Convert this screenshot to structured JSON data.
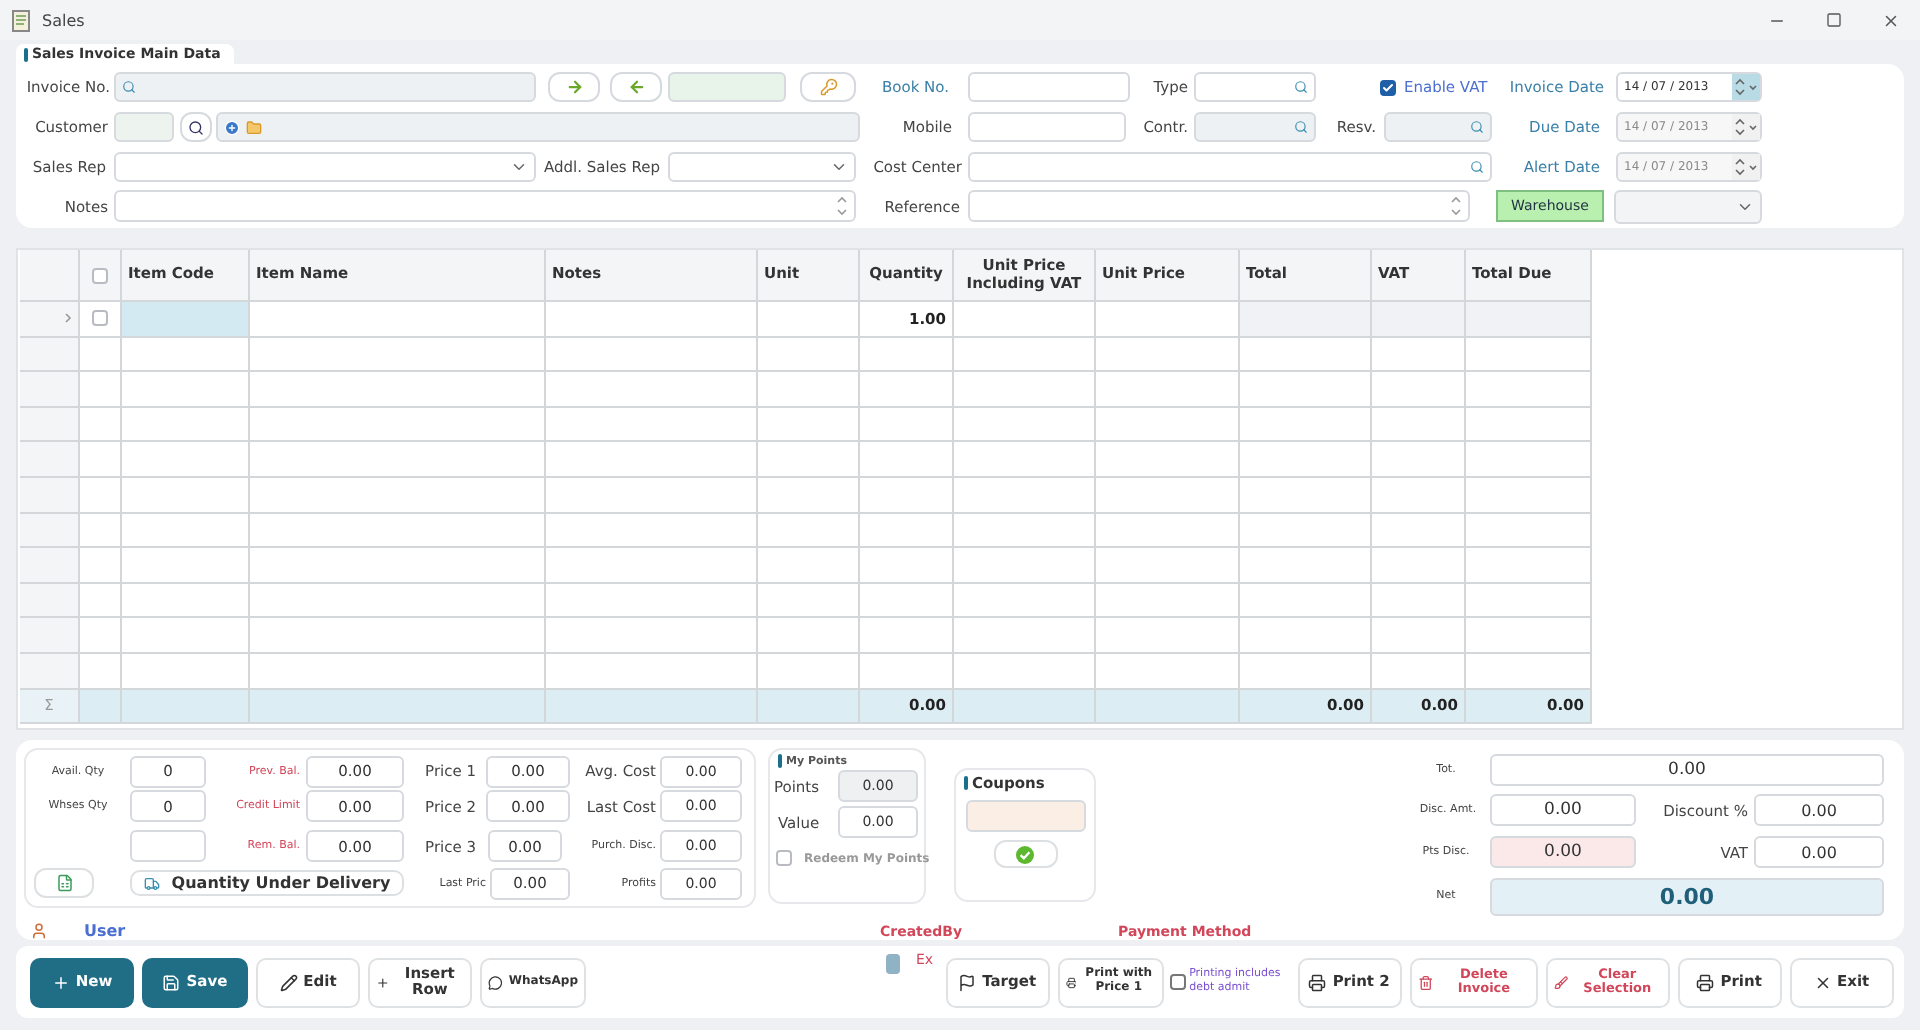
{
  "window": {
    "title": "Sales"
  },
  "main_data": {
    "title": "Sales Invoice Main Data",
    "invoice_no": {
      "label": "Invoice No."
    },
    "book_no": {
      "label": "Book No."
    },
    "type": {
      "label": "Type"
    },
    "enable_vat": {
      "label": "Enable VAT",
      "checked": true
    },
    "invoice_date": {
      "label": "Invoice Date",
      "value": "14 / 07 / 2013",
      "disabled": false
    },
    "customer": {
      "label": "Customer"
    },
    "mobile": {
      "label": "Mobile"
    },
    "contr": {
      "label": "Contr."
    },
    "resv": {
      "label": "Resv."
    },
    "due_date": {
      "label": "Due Date",
      "value": "14 / 07 / 2013",
      "disabled": true
    },
    "sales_rep": {
      "label": "Sales Rep"
    },
    "addl_sales_rep": {
      "label": "Addl. Sales Rep"
    },
    "cost_center": {
      "label": "Cost Center"
    },
    "alert_date": {
      "label": "Alert Date",
      "value": "14 / 07 / 2013",
      "disabled": true
    },
    "notes": {
      "label": "Notes"
    },
    "reference": {
      "label": "Reference"
    },
    "warehouse_button": "Warehouse"
  },
  "table": {
    "columns": [
      "Item Code",
      "Item Name",
      "Notes",
      "Unit",
      "Quantity",
      "Unit Price Including VAT",
      "Unit Price",
      "Total",
      "VAT",
      "Total Due"
    ],
    "select_all_checked": false,
    "rows": [
      {
        "checked": false,
        "quantity": "1.00"
      }
    ],
    "footer": {
      "marker": "Σ",
      "quantity": "0.00",
      "total": "0.00",
      "vat": "0.00",
      "total_due": "0.00"
    }
  },
  "item_info": {
    "avail_qty": {
      "label": "Avail. Qty",
      "value": "0"
    },
    "whses_qty": {
      "label": "Whses Qty",
      "value": "0"
    },
    "prev_bal": {
      "label": "Prev. Bal.",
      "value": "0.00"
    },
    "credit_limit": {
      "label": "Credit Limit",
      "value": "0.00"
    },
    "rem_bal": {
      "label": "Rem. Bal.",
      "value": "0.00"
    },
    "price_1": {
      "label": "Price 1",
      "value": "0.00"
    },
    "price_2": {
      "label": "Price 2",
      "value": "0.00"
    },
    "price_3": {
      "label": "Price 3",
      "value": "0.00"
    },
    "last_price": {
      "label": "Last Pric",
      "value": "0.00"
    },
    "avg_cost": {
      "label": "Avg. Cost",
      "value": "0.00"
    },
    "last_cost": {
      "label": "Last Cost",
      "value": "0.00"
    },
    "purch_disc": {
      "label": "Purch. Disc.",
      "value": "0.00"
    },
    "profits": {
      "label": "Profits",
      "value": "0.00"
    },
    "qty_under_delivery": "Quantity Under Delivery"
  },
  "my_points": {
    "title": "My Points",
    "points": {
      "label": "Points",
      "value": "0.00"
    },
    "value": {
      "label": "Value",
      "value": "0.00"
    },
    "redeem": {
      "label": "Redeem My Points",
      "checked": false
    }
  },
  "coupons": {
    "title": "Coupons"
  },
  "totals": {
    "tot": {
      "label": "Tot.",
      "value": "0.00"
    },
    "disc_amt": {
      "label": "Disc. Amt.",
      "value": "0.00"
    },
    "discount_pct": {
      "label": "Discount %",
      "value": "0.00"
    },
    "pts_disc": {
      "label": "Pts Disc.",
      "value": "0.00"
    },
    "vat": {
      "label": "VAT",
      "value": "0.00"
    },
    "net": {
      "label": "Net",
      "value": "0.00"
    }
  },
  "info_labels": {
    "user": "User",
    "created_by": "CreatedBy",
    "payment_method": "Payment Method"
  },
  "toolbar_left": [
    {
      "kind": "new",
      "label": "New"
    },
    {
      "kind": "save",
      "label": "Save"
    },
    {
      "kind": "edit",
      "label": "Edit"
    },
    {
      "kind": "insert",
      "label": "Insert Row"
    },
    {
      "kind": "whatsapp",
      "label": "WhatsApp"
    }
  ],
  "extra": {
    "label": "Ex"
  },
  "toolbar_right": [
    {
      "kind": "target",
      "label": "Target"
    },
    {
      "kind": "print_price",
      "label": "Print with Price 1"
    },
    {
      "kind": "checkbox",
      "label": "Printing includes debt admit",
      "checked": false
    },
    {
      "kind": "print2",
      "label": "Print 2"
    },
    {
      "kind": "delete",
      "label": "Delete Invoice"
    },
    {
      "kind": "clear",
      "label": "Clear Selection"
    },
    {
      "kind": "print",
      "label": "Print"
    },
    {
      "kind": "exit",
      "label": "Exit"
    }
  ]
}
